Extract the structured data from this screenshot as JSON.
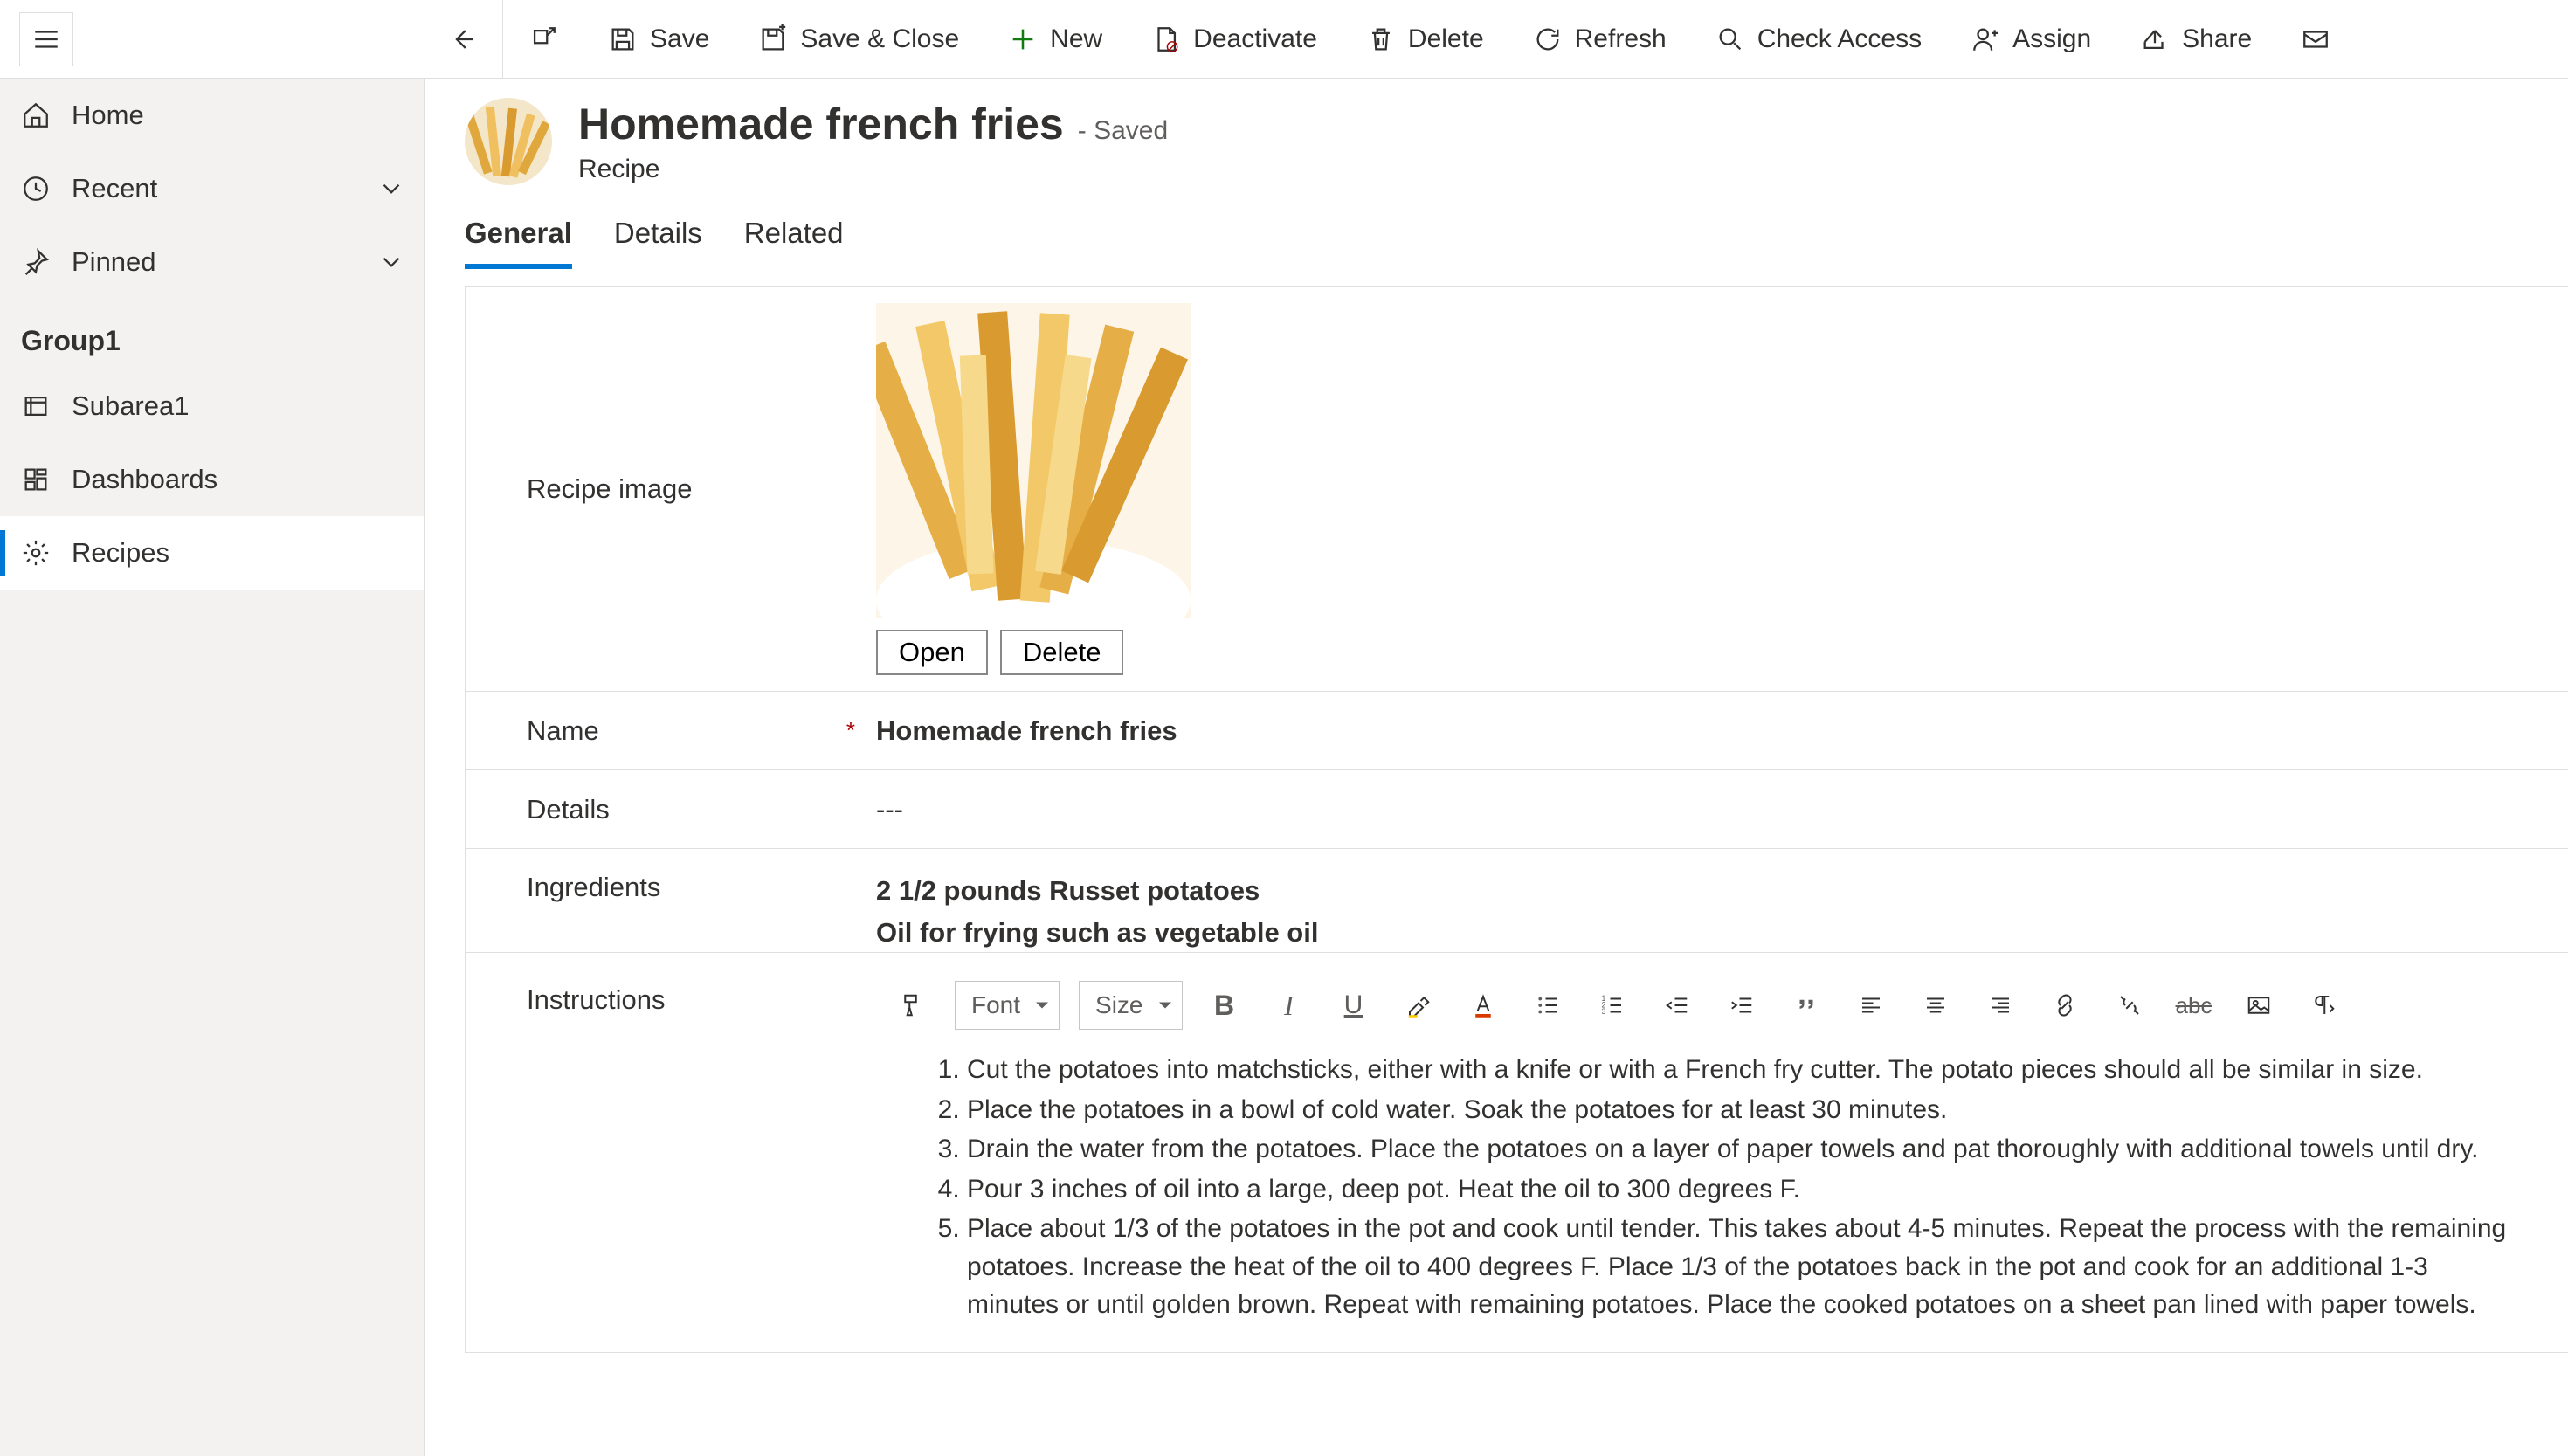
{
  "cmdbar": {
    "save": "Save",
    "save_close": "Save & Close",
    "new": "New",
    "deactivate": "Deactivate",
    "delete": "Delete",
    "refresh": "Refresh",
    "check_access": "Check Access",
    "assign": "Assign",
    "share": "Share"
  },
  "nav": {
    "home": "Home",
    "recent": "Recent",
    "pinned": "Pinned",
    "group1": "Group1",
    "subarea1": "Subarea1",
    "dashboards": "Dashboards",
    "recipes": "Recipes"
  },
  "header": {
    "title": "Homemade french fries",
    "saved": "- Saved",
    "entity": "Recipe"
  },
  "tabs": {
    "general": "General",
    "details": "Details",
    "related": "Related"
  },
  "image_field": {
    "label": "Recipe image",
    "open": "Open",
    "delete": "Delete"
  },
  "fields": {
    "name_label": "Name",
    "name_value": "Homemade french fries",
    "details_label": "Details",
    "details_value": "---",
    "ingredients_label": "Ingredients",
    "ingredients_line1": "2 1/2 pounds Russet potatoes",
    "ingredients_line2": "Oil for frying such as vegetable oil",
    "instructions_label": "Instructions"
  },
  "rte": {
    "font": "Font",
    "size": "Size"
  },
  "instructions": [
    "Cut the potatoes into matchsticks, either with a knife or with a French fry cutter. The potato pieces should all be similar in size.",
    "Place the potatoes in a bowl of cold water. Soak the potatoes for at least 30 minutes.",
    "Drain the water from the potatoes. Place the potatoes on a layer of paper towels and pat thoroughly with additional towels until dry.",
    "Pour 3 inches of oil into a large, deep pot. Heat the oil to 300 degrees F.",
    "Place about 1/3 of the potatoes in the pot and cook until tender. This takes about 4-5 minutes. Repeat the process with the remaining potatoes. Increase the heat of the oil to 400 degrees F. Place 1/3 of the potatoes back in the pot and cook for an additional 1-3 minutes or until golden brown. Repeat with remaining potatoes. Place the cooked potatoes on a sheet pan lined with paper towels."
  ]
}
